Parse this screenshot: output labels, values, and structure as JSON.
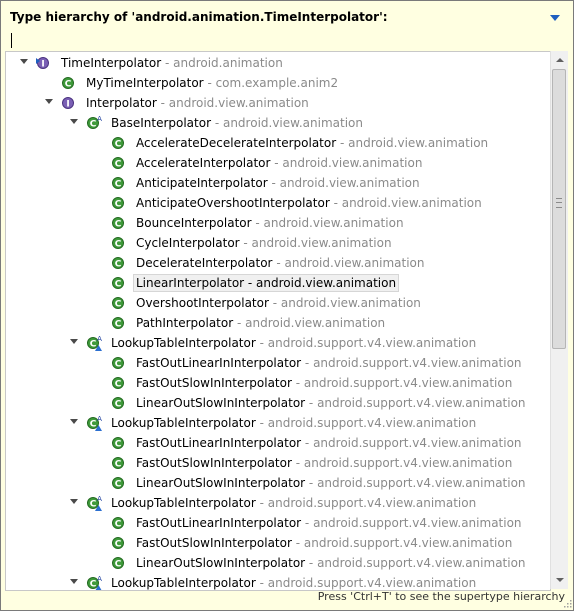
{
  "header": {
    "title": "Type hierarchy of 'android.animation.TimeInterpolator':",
    "filter_value": ""
  },
  "icons": {
    "interface": "interface-icon",
    "class": "class-icon",
    "abstract_class": "abstract-class-icon",
    "inner_class": "inner-class-icon"
  },
  "colors": {
    "popup_bg": "#ffffe1",
    "class_icon": "#3f9a3a",
    "interface_icon": "#7a5fb4",
    "package_text": "#8a8a8a"
  },
  "tree": [
    {
      "name": "TimeInterpolator",
      "pkg": " - android.animation",
      "level": 0,
      "icon": "interface-root",
      "twisty": "down"
    },
    {
      "name": "MyTimeInterpolator",
      "pkg": " - com.example.anim2",
      "level": 1,
      "icon": "class",
      "twisty": ""
    },
    {
      "name": "Interpolator",
      "pkg": " - android.view.animation",
      "level": 1,
      "icon": "interface",
      "twisty": "down"
    },
    {
      "name": "BaseInterpolator",
      "pkg": " - android.view.animation",
      "level": 2,
      "icon": "abstract-class",
      "twisty": "down"
    },
    {
      "name": "AccelerateDecelerateInterpolator",
      "pkg": " - android.view.animation",
      "level": 3,
      "icon": "class",
      "twisty": ""
    },
    {
      "name": "AccelerateInterpolator",
      "pkg": " - android.view.animation",
      "level": 3,
      "icon": "class",
      "twisty": ""
    },
    {
      "name": "AnticipateInterpolator",
      "pkg": " - android.view.animation",
      "level": 3,
      "icon": "class",
      "twisty": ""
    },
    {
      "name": "AnticipateOvershootInterpolator",
      "pkg": " - android.view.animation",
      "level": 3,
      "icon": "class",
      "twisty": ""
    },
    {
      "name": "BounceInterpolator",
      "pkg": " - android.view.animation",
      "level": 3,
      "icon": "class",
      "twisty": ""
    },
    {
      "name": "CycleInterpolator",
      "pkg": " - android.view.animation",
      "level": 3,
      "icon": "class",
      "twisty": ""
    },
    {
      "name": "DecelerateInterpolator",
      "pkg": " - android.view.animation",
      "level": 3,
      "icon": "class",
      "twisty": ""
    },
    {
      "name": "LinearInterpolator",
      "pkg": " - android.view.animation",
      "level": 3,
      "icon": "class",
      "twisty": "",
      "selected": true
    },
    {
      "name": "OvershootInterpolator",
      "pkg": " - android.view.animation",
      "level": 3,
      "icon": "class",
      "twisty": ""
    },
    {
      "name": "PathInterpolator",
      "pkg": " - android.view.animation",
      "level": 3,
      "icon": "class",
      "twisty": ""
    },
    {
      "name": "LookupTableInterpolator",
      "pkg": " - android.support.v4.view.animation",
      "level": 2,
      "icon": "abstract-inner",
      "twisty": "down"
    },
    {
      "name": "FastOutLinearInInterpolator",
      "pkg": " - android.support.v4.view.animation",
      "level": 3,
      "icon": "class",
      "twisty": ""
    },
    {
      "name": "FastOutSlowInInterpolator",
      "pkg": " - android.support.v4.view.animation",
      "level": 3,
      "icon": "class",
      "twisty": ""
    },
    {
      "name": "LinearOutSlowInInterpolator",
      "pkg": " - android.support.v4.view.animation",
      "level": 3,
      "icon": "class",
      "twisty": ""
    },
    {
      "name": "LookupTableInterpolator",
      "pkg": " - android.support.v4.view.animation",
      "level": 2,
      "icon": "abstract-inner",
      "twisty": "down"
    },
    {
      "name": "FastOutLinearInInterpolator",
      "pkg": " - android.support.v4.view.animation",
      "level": 3,
      "icon": "class",
      "twisty": ""
    },
    {
      "name": "FastOutSlowInInterpolator",
      "pkg": " - android.support.v4.view.animation",
      "level": 3,
      "icon": "class",
      "twisty": ""
    },
    {
      "name": "LinearOutSlowInInterpolator",
      "pkg": " - android.support.v4.view.animation",
      "level": 3,
      "icon": "class",
      "twisty": ""
    },
    {
      "name": "LookupTableInterpolator",
      "pkg": " - android.support.v4.view.animation",
      "level": 2,
      "icon": "abstract-inner",
      "twisty": "down"
    },
    {
      "name": "FastOutLinearInInterpolator",
      "pkg": " - android.support.v4.view.animation",
      "level": 3,
      "icon": "class",
      "twisty": ""
    },
    {
      "name": "FastOutSlowInInterpolator",
      "pkg": " - android.support.v4.view.animation",
      "level": 3,
      "icon": "class",
      "twisty": ""
    },
    {
      "name": "LinearOutSlowInInterpolator",
      "pkg": " - android.support.v4.view.animation",
      "level": 3,
      "icon": "class",
      "twisty": ""
    },
    {
      "name": "LookupTableInterpolator",
      "pkg": " - android.support.v4.view.animation",
      "level": 2,
      "icon": "abstract-inner",
      "twisty": "down"
    }
  ],
  "status": {
    "hint": "Press 'Ctrl+T' to see the supertype hierarchy"
  }
}
